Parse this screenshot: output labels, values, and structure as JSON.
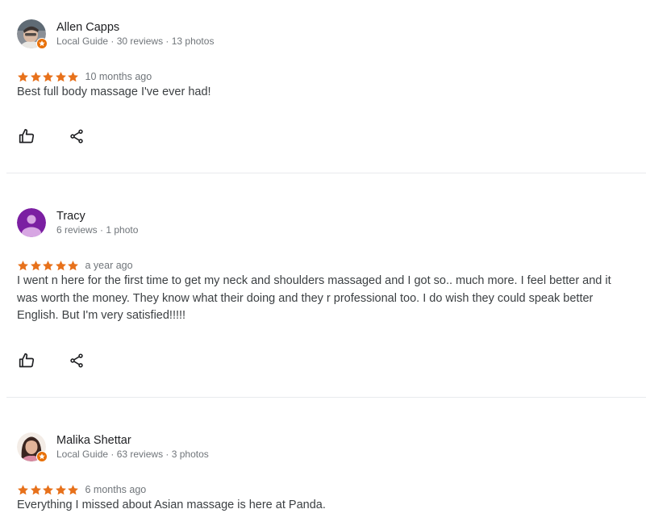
{
  "reviews": [
    {
      "author": "Allen Capps",
      "meta": "Local Guide · 30 reviews · 13 photos",
      "local_guide": true,
      "avatar_icon": "profile-photo-man",
      "rating": 5,
      "date": "10 months ago",
      "text": "Best full body massage I've ever had!"
    },
    {
      "author": "Tracy",
      "meta": "6 reviews · 1 photo",
      "local_guide": false,
      "avatar_icon": "default-person-avatar",
      "rating": 5,
      "date": "a year ago",
      "text": "I went n here for the first time to get my neck and shoulders massaged and I got so.. much more. I feel better and it was worth the money. They know what their doing and they r professional too. I do wish they could speak better English. But I'm very satisfied!!!!!"
    },
    {
      "author": "Malika Shettar",
      "meta": "Local Guide · 63 reviews · 3 photos",
      "local_guide": true,
      "avatar_icon": "profile-photo-woman",
      "rating": 5,
      "date": "6 months ago",
      "text": "Everything I missed about Asian massage is here at Panda."
    }
  ],
  "actions": {
    "like_icon": "thumbs-up-icon",
    "share_icon": "share-icon"
  },
  "colors": {
    "star": "#e7711b",
    "guide_badge": "#e8710a",
    "meta_text": "#70757a",
    "divider": "#e8eaed",
    "tracy_avatar": "#7b1fa2"
  }
}
